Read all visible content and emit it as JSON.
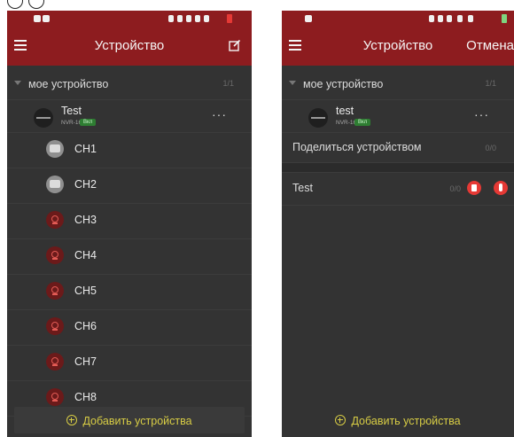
{
  "colors": {
    "appbar": "#8d1c1f",
    "background": "#333333",
    "accent_yellow": "#d8cd45",
    "status_badge": "#2e7d32",
    "danger_red": "#e53935"
  },
  "left_screen": {
    "header": {
      "title": "Устройство",
      "menu_icon": "hamburger-menu-icon",
      "edit_icon": "edit-icon"
    },
    "group": {
      "label": "мое устройство",
      "count": "1/1"
    },
    "device": {
      "name": "Test",
      "model": "NVR-16",
      "status": "Вкл",
      "more": "···"
    },
    "channels": [
      {
        "label": "CH1",
        "icon": "camera-preview-thumbnail"
      },
      {
        "label": "CH2",
        "icon": "camera-preview-thumbnail"
      },
      {
        "label": "CH3",
        "icon": "camera-icon"
      },
      {
        "label": "CH4",
        "icon": "camera-icon"
      },
      {
        "label": "CH5",
        "icon": "camera-icon"
      },
      {
        "label": "CH6",
        "icon": "camera-icon"
      },
      {
        "label": "CH7",
        "icon": "camera-icon"
      },
      {
        "label": "CH8",
        "icon": "camera-icon"
      }
    ],
    "add_button": "Добавить устройства"
  },
  "right_screen": {
    "header": {
      "title": "Устройство",
      "cancel": "Отмена",
      "menu_icon": "hamburger-menu-icon"
    },
    "group": {
      "label": "мое устройство",
      "count": "1/1"
    },
    "device": {
      "name": "test",
      "model": "NVR-16",
      "status": "Вкл",
      "more": "···"
    },
    "share": {
      "label": "Поделиться устройством",
      "count": "0/0"
    },
    "shared_device": {
      "label": "Test",
      "count": "0/0",
      "delete_icon": "trash-icon",
      "mic_icon": "microphone-icon"
    },
    "add_button": "Добавить устройства"
  }
}
